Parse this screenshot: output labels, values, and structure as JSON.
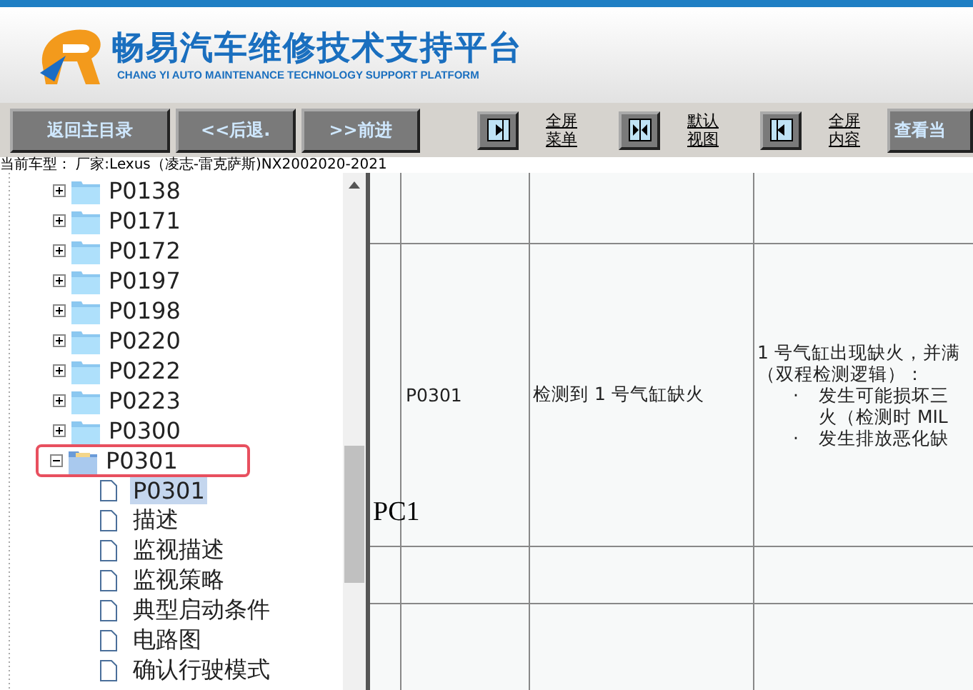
{
  "header": {
    "title": "畅易汽车维修技术支持平台",
    "subtitle": "CHANG YI AUTO MAINTENANCE TECHNOLOGY SUPPORT PLATFORM"
  },
  "toolbar": {
    "nav_buttons": [
      "返回主目录",
      "<<后退.",
      ">>前进"
    ],
    "view_buttons": [
      {
        "kind": "menu",
        "label_lines": [
          "全屏",
          "菜单"
        ]
      },
      {
        "kind": "default",
        "label_lines": [
          "默认",
          "视图"
        ]
      },
      {
        "kind": "content",
        "label_lines": [
          "全屏",
          "内容"
        ]
      }
    ],
    "last_button": "查看当"
  },
  "vehicle_info": "当前车型：  厂家:Lexus（凌志-雷克萨斯)NX2002020-2021",
  "tree": [
    {
      "label": "P0138",
      "expanded": false,
      "annotated": false
    },
    {
      "label": "P0171",
      "expanded": false,
      "annotated": false
    },
    {
      "label": "P0172",
      "expanded": false,
      "annotated": false
    },
    {
      "label": "P0197",
      "expanded": false,
      "annotated": false
    },
    {
      "label": "P0198",
      "expanded": false,
      "annotated": false
    },
    {
      "label": "P0220",
      "expanded": false,
      "annotated": false
    },
    {
      "label": "P0222",
      "expanded": false,
      "annotated": false
    },
    {
      "label": "P0223",
      "expanded": false,
      "annotated": false
    },
    {
      "label": "P0300",
      "expanded": false,
      "annotated": false
    },
    {
      "label": "P0301",
      "expanded": true,
      "annotated": true,
      "children": [
        {
          "label": "P0301",
          "selected": true
        },
        {
          "label": "描述",
          "selected": false
        },
        {
          "label": "监视描述",
          "selected": false
        },
        {
          "label": "监视策略",
          "selected": false
        },
        {
          "label": "典型启动条件",
          "selected": false
        },
        {
          "label": "电路图",
          "selected": false
        },
        {
          "label": "确认行驶模式",
          "selected": false
        }
      ]
    }
  ],
  "content": {
    "overlay_text": "PC1",
    "row": {
      "code": "P0301",
      "name": "检测到 1 号气缸缺火",
      "detail_lines": [
        "1 号气缸出现缺火，并满",
        "（双程检测逻辑）："
      ],
      "bullets": [
        {
          "mark": "·",
          "lines": [
            "发生可能损坏三",
            "火（检测时 MIL"
          ]
        },
        {
          "mark": "·",
          "lines": [
            "发生排放恶化缺"
          ]
        }
      ]
    }
  }
}
